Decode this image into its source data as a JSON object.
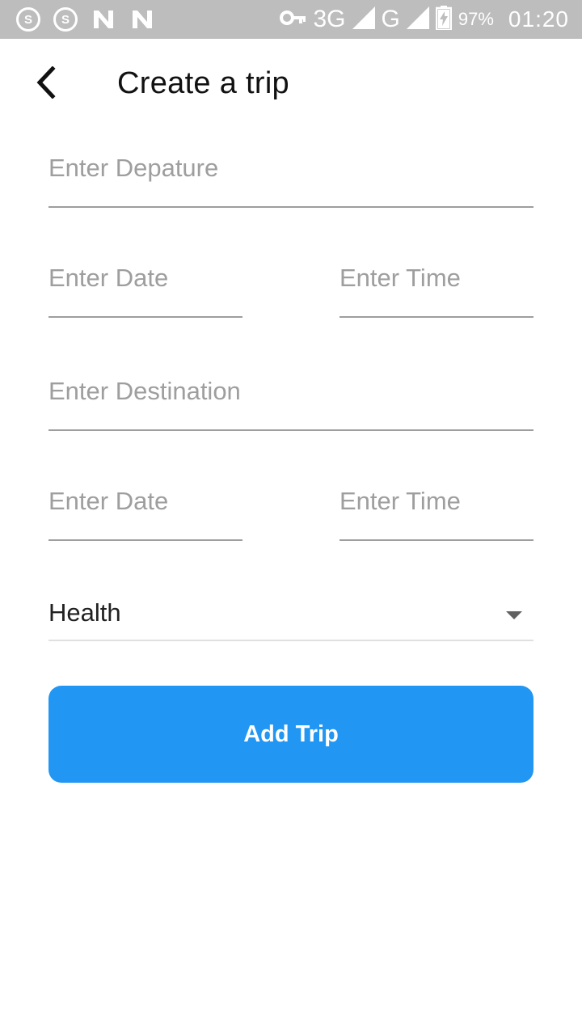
{
  "status_bar": {
    "left_icons": [
      {
        "name": "s-circle-icon",
        "glyph": "S"
      },
      {
        "name": "s-circle-icon",
        "glyph": "S"
      },
      {
        "name": "n-icon"
      },
      {
        "name": "n-icon"
      }
    ],
    "key_icon": "key-icon",
    "network_3g": "3G",
    "network_g": "G",
    "battery_percent": "97%",
    "time": "01:20",
    "background": "#bdbdbd"
  },
  "header": {
    "back_icon": "chevron-left-icon",
    "title": "Create a trip"
  },
  "form": {
    "departure": {
      "value": "",
      "placeholder": "Enter Depature"
    },
    "departure_date": {
      "value": "",
      "placeholder": "Enter Date"
    },
    "departure_time": {
      "value": "",
      "placeholder": "Enter Time"
    },
    "destination": {
      "value": "",
      "placeholder": "Enter Destination"
    },
    "arrival_date": {
      "value": "",
      "placeholder": "Enter Date"
    },
    "arrival_time": {
      "value": "",
      "placeholder": "Enter Time"
    },
    "category": {
      "selected": "Health",
      "icon": "dropdown-arrow-icon"
    },
    "submit_label": "Add Trip"
  },
  "colors": {
    "accent": "#2196f3",
    "placeholder": "#9e9e9e",
    "underline": "#9e9e9e"
  }
}
